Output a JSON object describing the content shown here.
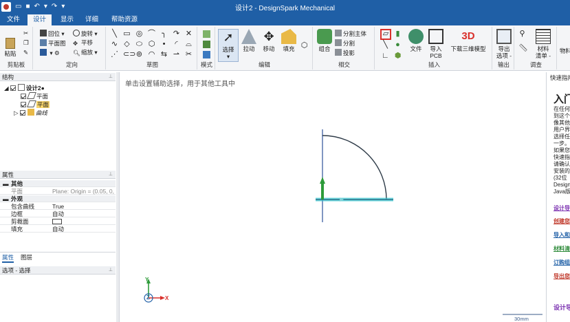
{
  "window": {
    "title": "设计2 - DesignSpark Mechanical"
  },
  "quick_access": {
    "undo_glyph": "↶",
    "redo_glyph": "↷",
    "dropdown_glyph": "▾"
  },
  "tabs": [
    {
      "label": "文件"
    },
    {
      "label": "设计"
    },
    {
      "label": "显示"
    },
    {
      "label": "详细"
    },
    {
      "label": "帮助资源"
    }
  ],
  "ribbon": {
    "clipboard": {
      "label": "剪贴板",
      "paste": "粘贴"
    },
    "orient": {
      "label": "定向",
      "home": "回位",
      "rotate": "旋转",
      "plan_view": "平面图",
      "pan": "平移",
      "zoom": "缩放"
    },
    "sketch": {
      "label": "草图"
    },
    "mode": {
      "label": "模式"
    },
    "edit": {
      "label": "编辑",
      "select": "选择",
      "pull": "拉动",
      "move": "移动",
      "fill": "填充"
    },
    "intersect": {
      "label": "相交",
      "combine": "组合",
      "split_body": "分割主体",
      "split": "分割",
      "project": "投影"
    },
    "insert": {
      "label": "插入",
      "file": "文件",
      "import_pcb_line1": "导入",
      "import_pcb_line2": "PCB",
      "download_3d": "下载三维模型",
      "three_d_badge": "3D"
    },
    "output": {
      "label": "输出",
      "export_line1": "导出",
      "export_line2": "选项 -"
    },
    "survey": {
      "label": "调查",
      "bom_line1": "材料",
      "bom_line2": "清单 -"
    },
    "extra": {
      "label": "物料"
    }
  },
  "structure": {
    "title": "结构",
    "root": "设计2●",
    "items": [
      {
        "label": "平面"
      },
      {
        "label": "平面"
      },
      {
        "label": "曲线"
      }
    ]
  },
  "properties": {
    "title": "属性",
    "categories": [
      {
        "name": "其他",
        "rows": [
          {
            "key": "平面",
            "value": "Plane: Origin = (0.05, 0, 0),"
          }
        ]
      },
      {
        "name": "外观",
        "rows": [
          {
            "key": "包含曲线",
            "value": "True"
          },
          {
            "key": "边框",
            "value": "自动"
          },
          {
            "key": "剪裁面",
            "value": ""
          },
          {
            "key": "填充",
            "value": "自动"
          }
        ]
      }
    ],
    "tabs": [
      {
        "label": "属性"
      },
      {
        "label": "图层"
      }
    ]
  },
  "options_panel": {
    "title": "选项 - 选择"
  },
  "canvas": {
    "hint": "单击设置辅助选择，用于其他工具中",
    "scale_label": "30mm",
    "axis_x": "X",
    "axis_y": "Y",
    "axis_z": "Z"
  },
  "right_panel": {
    "title": "快速指南",
    "heading": "入门",
    "lines": [
      "在任何",
      "到这个",
      "像其他",
      "用户界",
      "选择任",
      "一步。",
      "如果您",
      "快速指",
      "请确认",
      "安装的",
      "(32位",
      "Design",
      "Java版"
    ],
    "links": [
      {
        "label": "设计导",
        "color": "#7a2fb0"
      },
      {
        "label": "创建您",
        "color": "#c0392b"
      },
      {
        "label": "导入和",
        "color": "#1f5fa6"
      },
      {
        "label": "材料清",
        "color": "#2e8b3a"
      },
      {
        "label": "订购组",
        "color": "#1f5fa6"
      },
      {
        "label": "导出您",
        "color": "#c0392b"
      }
    ],
    "footer": "设计导"
  },
  "colors": {
    "titlebar": "#1f5fa6",
    "selected_plane": "#39c6cf",
    "axis_x": "#d9302b",
    "axis_y": "#2e9b3a",
    "axis_z": "#1f5fa6",
    "highlight": "#d9302b"
  }
}
